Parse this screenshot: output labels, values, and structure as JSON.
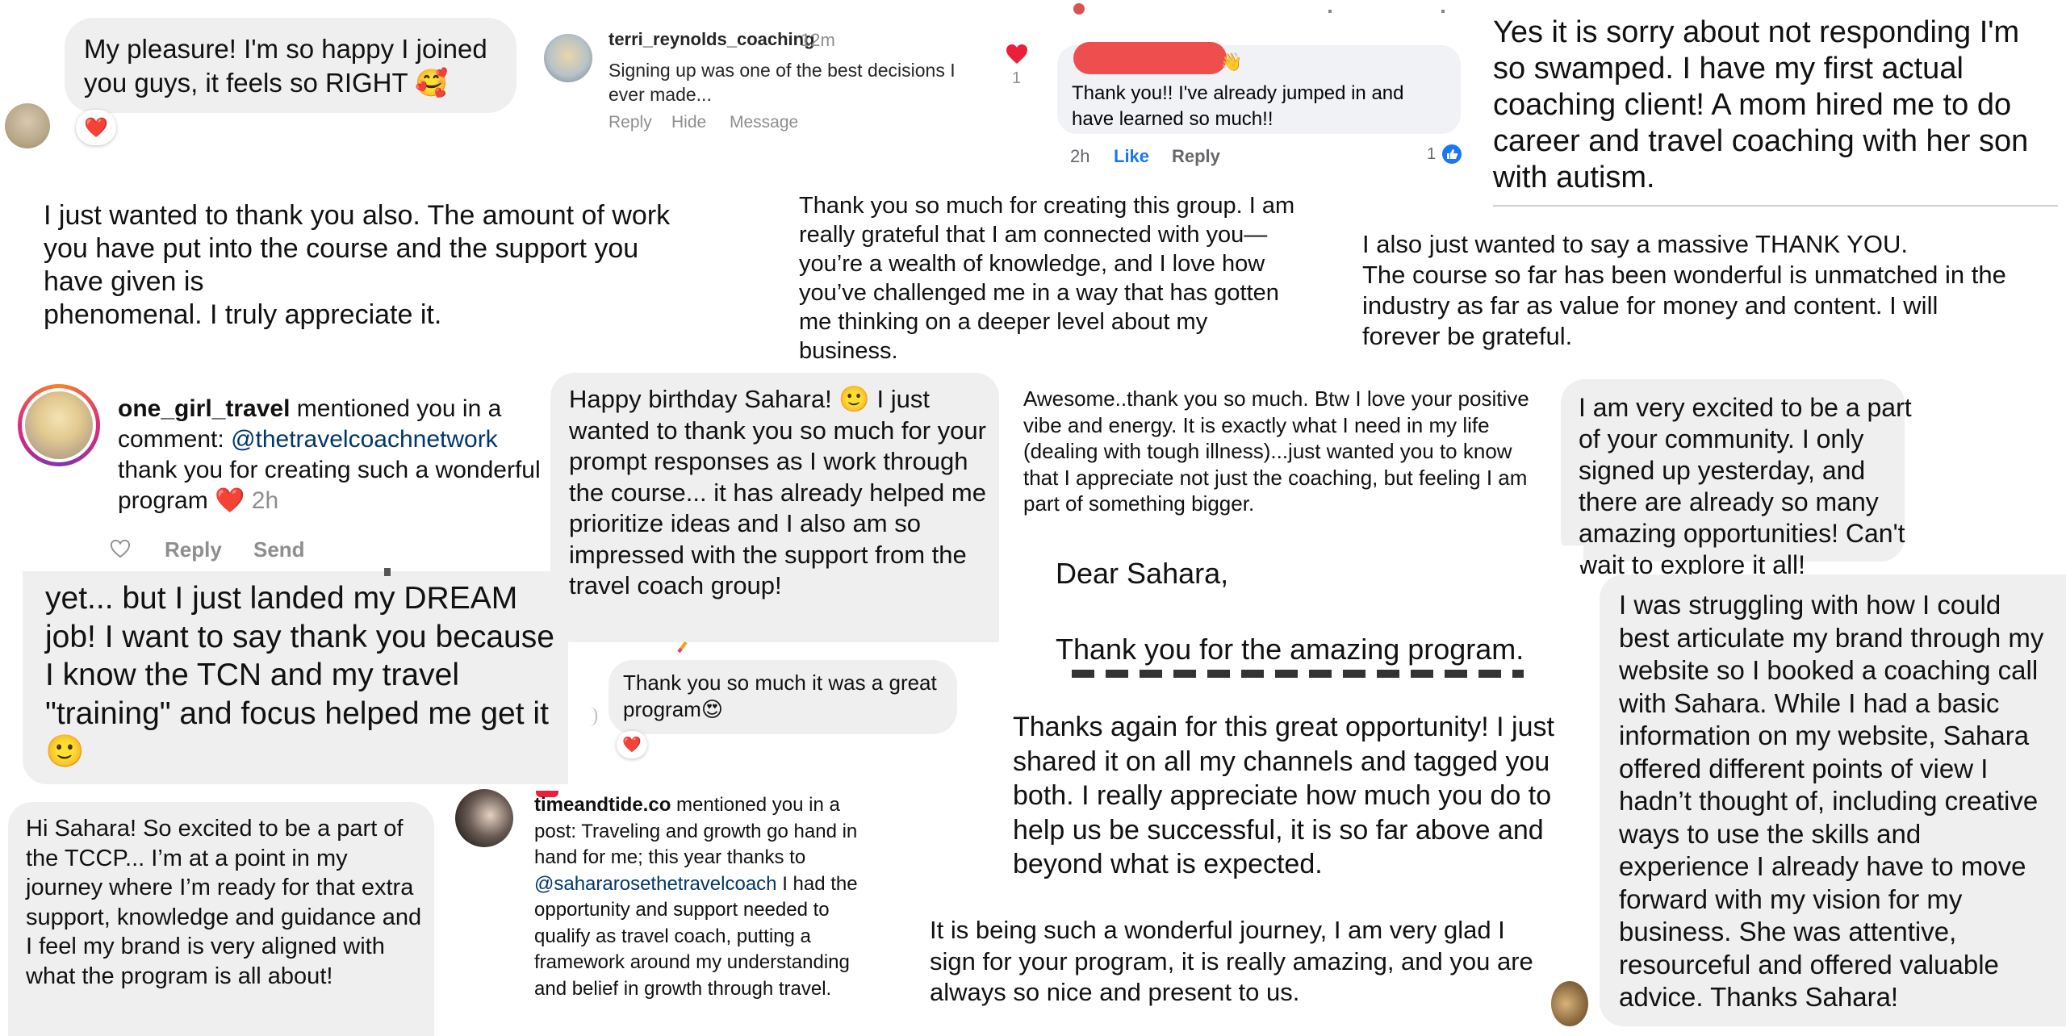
{
  "cards": {
    "c1": {
      "text": "My pleasure! I'm so happy I joined you guys, it feels so RIGHT 🥰",
      "reaction": "❤️"
    },
    "c2": {
      "username": "terri_reynolds_coaching",
      "time": "12m",
      "text": "Signing up was one of the best decisions I ever made...",
      "reply": "Reply",
      "hide": "Hide",
      "message": "Message",
      "like_count": "1"
    },
    "c3": {
      "text": "Thank you!! I've already jumped in and have learned so much!!",
      "time": "2h",
      "like": "Like",
      "reply": "Reply",
      "count": "1"
    },
    "c4": {
      "text": "Yes it is sorry about not responding I'm so swamped. I have my first actual coaching client! A mom hired me to do career and travel coaching with her son with autism."
    },
    "c5": {
      "text": "I just wanted to thank you also. The amount of work you have put into the course and the support you have given  is\nphenomenal. I truly appreciate it."
    },
    "c6": {
      "text": "Thank you so much for creating this group. I am really grateful that I am connected with you—you’re a wealth of knowledge, and I love how you’ve challenged me in a way that has gotten me thinking on a deeper level about my business."
    },
    "c7": {
      "text": "I also just wanted to say a massive THANK YOU.\n The course so far has been wonderful is unmatched in the industry as far as value for money and content.  I will forever be grateful."
    },
    "c8": {
      "username": "one_girl_travel",
      "mention": "mentioned you in a comment:",
      "handle": "@thetravelcoachnetwork",
      "text": "thank you for creating such a wonderful program",
      "heart": "❤️",
      "time": "2h",
      "reply": "Reply",
      "send": "Send"
    },
    "c9": {
      "text": "Happy birthday Sahara! 🙂 I just wanted to thank you so much for your prompt responses as I work through the course... it has already helped me prioritize ideas and I also am so impressed with the support from the travel coach group!"
    },
    "c10": {
      "text": "Awesome..thank you so much.  Btw I love your positive vibe and energy.  It is exactly what I need in my life (dealing with tough illness)...just wanted you to know that I appreciate not just the coaching, but feeling I am part of something bigger."
    },
    "c11": {
      "text": "I am very excited to be a part of your community. I only signed up yesterday, and there are already so many amazing opportunities! Can't wait to explore it all!"
    },
    "c12": {
      "text": "yet... but I just landed my DREAM job! I want to say thank you because I know the TCN and my travel \"training\" and focus helped me get it 🙂"
    },
    "c13": {
      "text": "Thank you so much it was a great program😍",
      "reaction": "❤️"
    },
    "c14": {
      "greeting": "Dear Sahara,",
      "text": "Thank you for the amazing program."
    },
    "c15": {
      "text": "I was struggling with how I could best articulate my brand through my website so I booked a coaching call with Sahara. While I had a basic information on my website, Sahara offered different points of view I hadn’t thought of, including creative ways to use the skills and experience I already have to move forward with my vision for my business. She was attentive, resourceful and offered valuable advice. Thanks Sahara!"
    },
    "c16": {
      "text": "Thanks again for this great opportunity! I just shared it on all my channels and tagged you both. I really appreciate how much you do to help us be successful, it is so far above and beyond what is expected."
    },
    "c17": {
      "text": "Hi Sahara! So excited to be a part of the TCCP... I’m at a point in my journey where I’m ready for that extra support, knowledge and guidance and I feel my brand is very aligned with what the program is all about!"
    },
    "c18": {
      "username": "timeandtide.co",
      "pre": "mentioned you in a post: Traveling and growth go hand in hand for me; this year thanks to",
      "handle": "@sahararosethetravelcoach",
      "post": "I had the opportunity and support needed to qualify as travel coach, putting a framework around my understanding and belief in growth through travel."
    },
    "c19": {
      "text": "It is being such a wonderful journey, I am very glad I sign for your program, it is really amazing, and you are always so nice and present to us."
    }
  },
  "colors": {
    "ig_bubble": "#efefef",
    "fb_bubble": "#f0f2f5",
    "heart": "#ed1e3a",
    "fb_blue": "#1877f2",
    "ig_link": "#00376b"
  },
  "icons": [
    "heart-icon",
    "like-thumb-icon",
    "waving-hand-icon"
  ]
}
